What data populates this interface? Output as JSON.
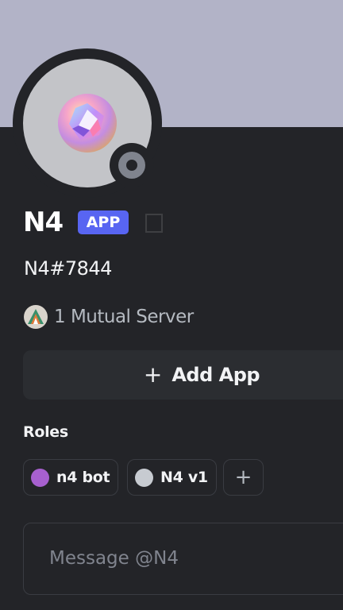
{
  "profile": {
    "display_name": "N4",
    "badge": "APP",
    "tag": "N4#7844",
    "status": "offline",
    "banner_color": "#b2b3c7",
    "accent_color": "#5865f2"
  },
  "mutual": {
    "text": "1 Mutual Server"
  },
  "actions": {
    "add_app_icon": "+",
    "add_app_label": "Add App"
  },
  "roles": {
    "heading": "Roles",
    "items": [
      {
        "label": "n4 bot",
        "color": "#a760cf"
      },
      {
        "label": "N4 v1",
        "color": "#c7cbd1"
      }
    ],
    "add_icon": "+"
  },
  "message": {
    "placeholder": "Message @N4"
  }
}
